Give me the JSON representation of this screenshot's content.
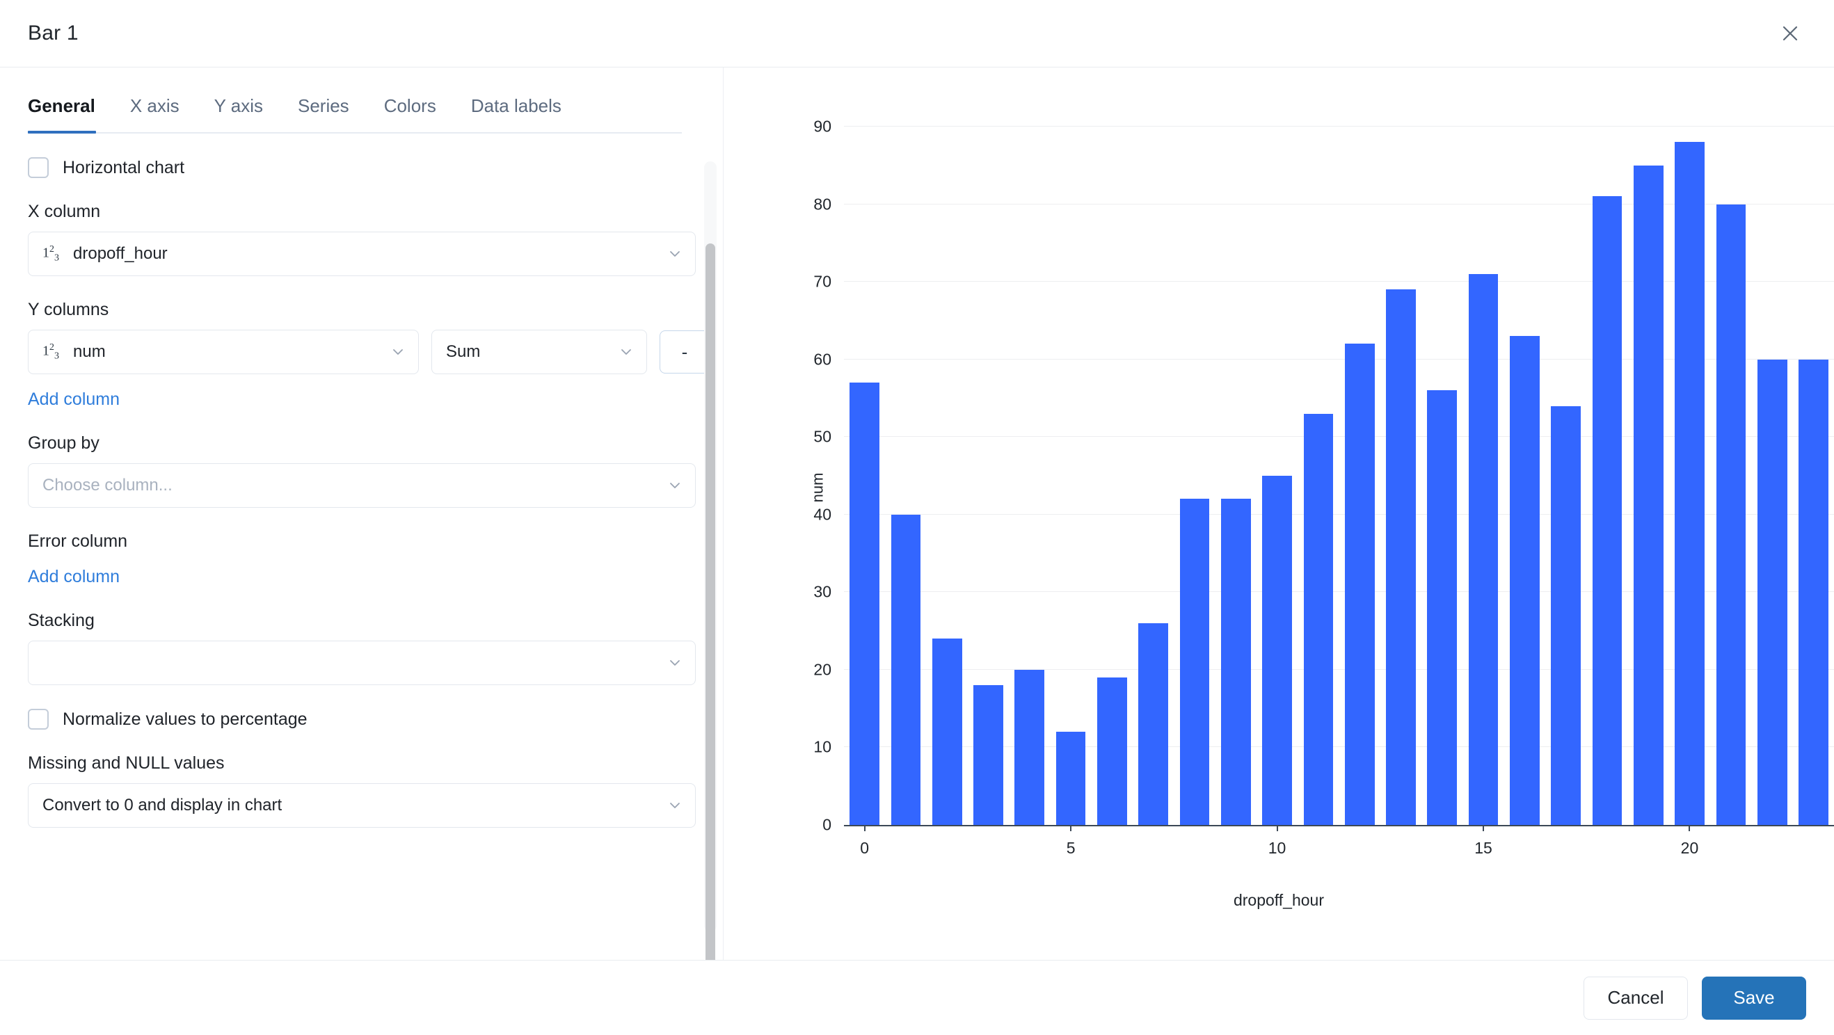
{
  "header": {
    "title": "Bar 1",
    "close_icon": "close-icon"
  },
  "tabs": [
    {
      "label": "General",
      "active": true
    },
    {
      "label": "X axis",
      "active": false
    },
    {
      "label": "Y axis",
      "active": false
    },
    {
      "label": "Series",
      "active": false
    },
    {
      "label": "Colors",
      "active": false
    },
    {
      "label": "Data labels",
      "active": false
    }
  ],
  "form": {
    "horizontal_chart": {
      "label": "Horizontal chart",
      "checked": false
    },
    "x_column": {
      "label": "X column",
      "value": "dropoff_hour",
      "type_icon": "number-type-icon"
    },
    "y_columns": {
      "label": "Y columns",
      "column_value": "num",
      "column_type_icon": "number-type-icon",
      "aggregate_value": "Sum",
      "remove_label": "-",
      "add_label": "Add column"
    },
    "group_by": {
      "label": "Group by",
      "placeholder": "Choose column...",
      "value": ""
    },
    "error_column": {
      "label": "Error column",
      "add_label": "Add column"
    },
    "stacking": {
      "label": "Stacking",
      "value": ""
    },
    "normalize": {
      "label": "Normalize values to percentage",
      "checked": false
    },
    "missing_null": {
      "label": "Missing and NULL values",
      "value": "Convert to 0 and display in chart"
    }
  },
  "footer": {
    "cancel_label": "Cancel",
    "save_label": "Save"
  },
  "colors": {
    "bar": "#3366ff",
    "primary_button": "#2573b8",
    "tab_active_underline": "#2f6fbe",
    "link": "#2f7ddb",
    "gridline": "#edeef0",
    "axis": "#3b4856"
  },
  "chart_data": {
    "type": "bar",
    "title": "",
    "xlabel": "dropoff_hour",
    "ylabel": "num",
    "ylim": [
      0,
      90
    ],
    "yticks": [
      0,
      10,
      20,
      30,
      40,
      50,
      60,
      70,
      80,
      90
    ],
    "xticks": [
      0,
      5,
      10,
      15,
      20
    ],
    "grid": true,
    "legend": "none",
    "categories": [
      0,
      1,
      2,
      3,
      4,
      5,
      6,
      7,
      8,
      9,
      10,
      11,
      12,
      13,
      14,
      15,
      16,
      17,
      18,
      19,
      20,
      21,
      22,
      23
    ],
    "values": [
      57,
      40,
      24,
      18,
      20,
      12,
      19,
      26,
      42,
      42,
      45,
      53,
      62,
      69,
      56,
      71,
      63,
      54,
      81,
      85,
      88,
      80,
      60,
      60
    ],
    "series": [
      {
        "name": "num",
        "values": [
          57,
          40,
          24,
          18,
          20,
          12,
          19,
          26,
          42,
          42,
          45,
          53,
          62,
          69,
          56,
          71,
          63,
          54,
          81,
          85,
          88,
          80,
          60,
          60
        ]
      }
    ]
  }
}
